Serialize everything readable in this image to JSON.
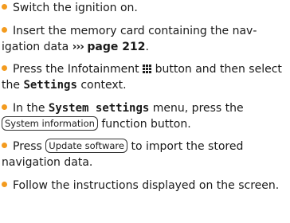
{
  "steps": [
    {
      "text": "Switch the ignition on."
    },
    {
      "text_before": "Insert the memory card containing the nav­igation data ",
      "arrows": "›››",
      "page_ref": "page 212",
      "text_after": "."
    },
    {
      "text_before": "Press the Infotainment ",
      "button_icon": "infotainment-grid-icon",
      "text_middle": " button and then select the ",
      "context_name": "Settings",
      "text_after": " context."
    },
    {
      "text_before": "In the ",
      "menu_name": "System settings",
      "text_middle": " menu, press the ",
      "button_label": "System information",
      "text_after": " function button."
    },
    {
      "text_before": "Press ",
      "button_label": "Update software",
      "text_after": " to import the stored navigation data."
    },
    {
      "text": "Follow the instructions displayed on the screen."
    }
  ],
  "colors": {
    "bullet": "#f39b1f",
    "text": "#1a1a1a"
  }
}
